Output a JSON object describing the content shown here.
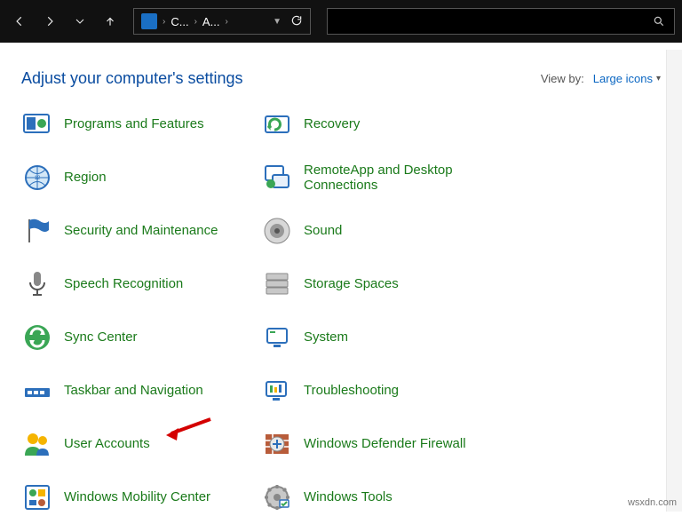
{
  "nav": {
    "breadcrumb1": "C...",
    "breadcrumb2": "A..."
  },
  "header": {
    "title": "Adjust your computer's settings",
    "view_by_label": "View by:",
    "view_by_value": "Large icons"
  },
  "items_left": [
    {
      "icon": "programs-icon",
      "label": "Programs and Features"
    },
    {
      "icon": "globe-icon",
      "label": "Region"
    },
    {
      "icon": "flag-icon",
      "label": "Security and Maintenance"
    },
    {
      "icon": "mic-icon",
      "label": "Speech Recognition"
    },
    {
      "icon": "sync-icon",
      "label": "Sync Center"
    },
    {
      "icon": "taskbar-icon",
      "label": "Taskbar and Navigation"
    },
    {
      "icon": "users-icon",
      "label": "User Accounts"
    },
    {
      "icon": "mobility-icon",
      "label": "Windows Mobility Center"
    }
  ],
  "items_right": [
    {
      "icon": "recovery-icon",
      "label": "Recovery"
    },
    {
      "icon": "remoteapp-icon",
      "label": "RemoteApp and Desktop Connections"
    },
    {
      "icon": "sound-icon",
      "label": "Sound"
    },
    {
      "icon": "storage-icon",
      "label": "Storage Spaces"
    },
    {
      "icon": "system-icon",
      "label": "System"
    },
    {
      "icon": "troubleshoot-icon",
      "label": "Troubleshooting"
    },
    {
      "icon": "firewall-icon",
      "label": "Windows Defender Firewall"
    },
    {
      "icon": "tools-icon",
      "label": "Windows Tools"
    }
  ],
  "watermark": "wsxdn.com"
}
